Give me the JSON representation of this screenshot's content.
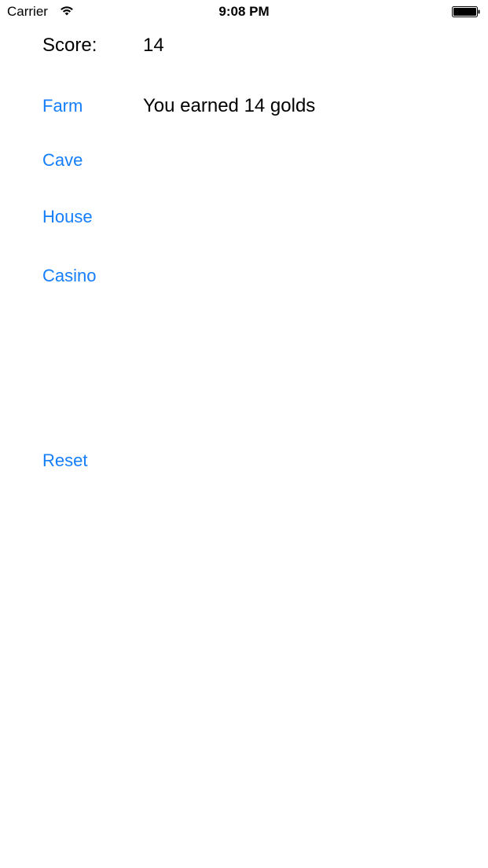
{
  "status_bar": {
    "carrier": "Carrier",
    "time": "9:08 PM",
    "icons": [
      "wifi-icon",
      "battery-icon"
    ]
  },
  "score": {
    "label": "Score:",
    "value": "14"
  },
  "message": "You earned 14 golds",
  "buttons": {
    "farm": "Farm",
    "cave": "Cave",
    "house": "House",
    "casino": "Casino",
    "reset": "Reset"
  },
  "colors": {
    "accent": "#147EFB",
    "text": "#000000",
    "background": "#FFFFFF"
  }
}
